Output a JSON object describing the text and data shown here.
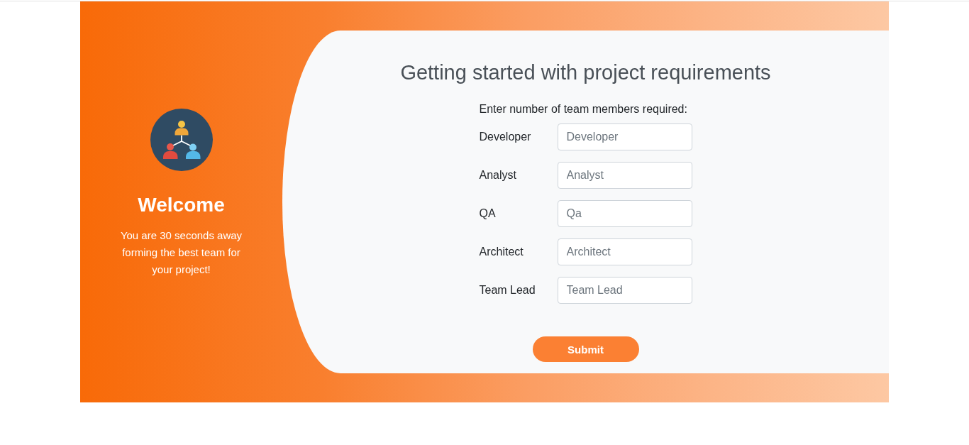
{
  "sidebar": {
    "title": "Welcome",
    "message": "You are 30 seconds away forming the best team for your project!"
  },
  "form": {
    "title": "Getting started with project requirements",
    "instructions": "Enter number of team members required:",
    "fields": [
      {
        "label": "Developer",
        "placeholder": "Developer"
      },
      {
        "label": "Analyst",
        "placeholder": "Analyst"
      },
      {
        "label": "QA",
        "placeholder": "Qa"
      },
      {
        "label": "Architect",
        "placeholder": "Architect"
      },
      {
        "label": "Team Lead",
        "placeholder": "Team Lead"
      }
    ],
    "submit": "Submit"
  }
}
